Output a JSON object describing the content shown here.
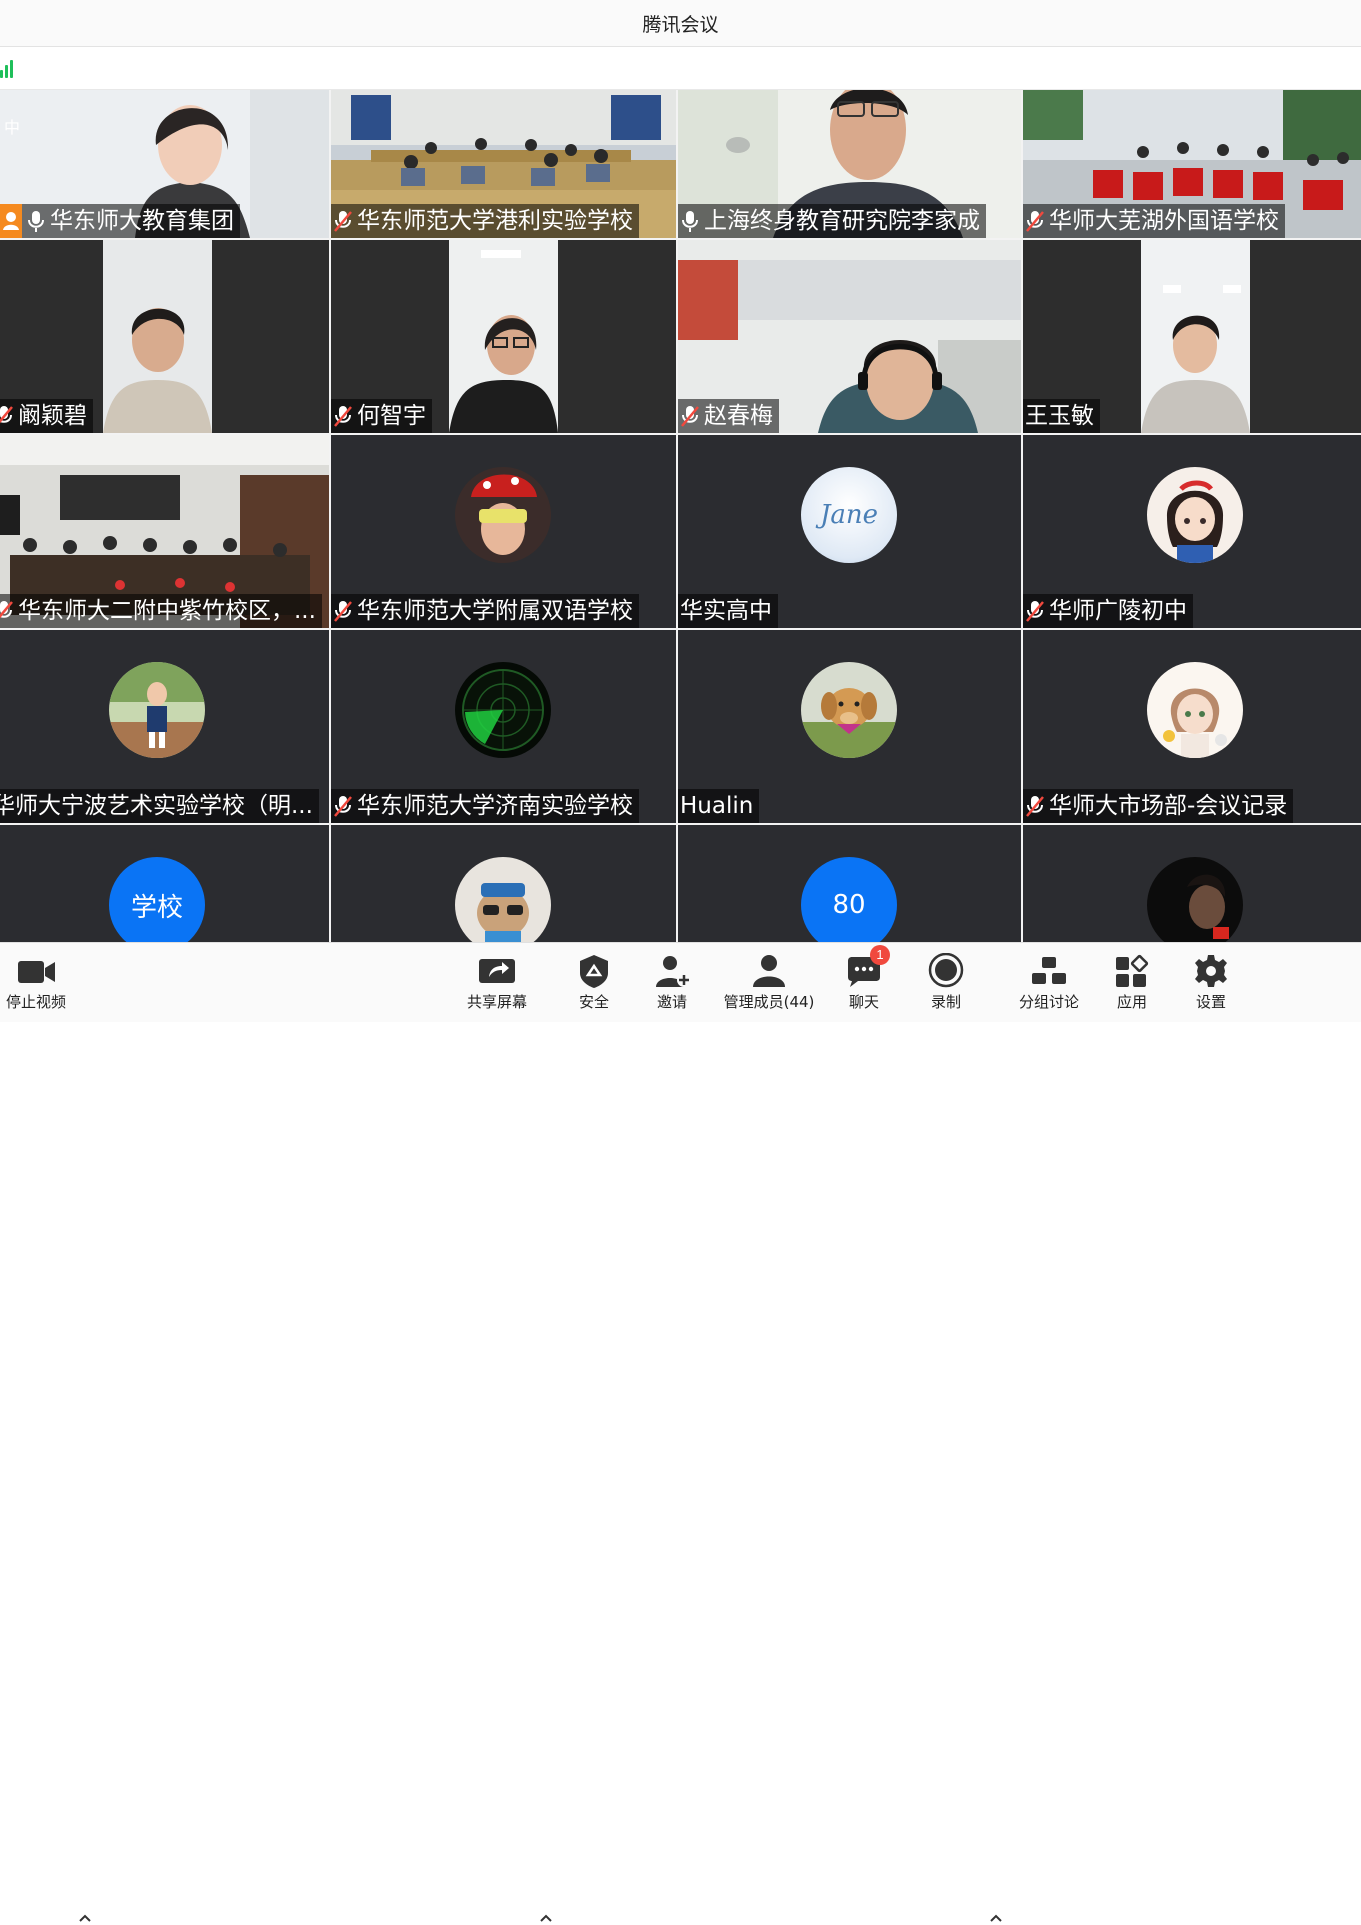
{
  "window": {
    "title": "腾讯会议"
  },
  "participants": [
    {
      "name": "华东师大教育集团",
      "mic": "on",
      "host_icon": true
    },
    {
      "name": "华东师范大学港利实验学校",
      "mic": "muted"
    },
    {
      "name": "上海终身教育研究院李家成",
      "mic": "on"
    },
    {
      "name": "华师大芜湖外国语学校",
      "mic": "muted"
    },
    {
      "name": "阚颖碧",
      "mic": "muted"
    },
    {
      "name": "何智宇",
      "mic": "muted"
    },
    {
      "name": "赵春梅",
      "mic": "muted"
    },
    {
      "name": "王玉敏",
      "mic": "none"
    },
    {
      "name": "华东师大二附中紫竹校区，...",
      "mic": "muted"
    },
    {
      "name": "华东师范大学附属双语学校",
      "mic": "muted"
    },
    {
      "name": "华实高中",
      "mic": "none",
      "avatar_text": "Jane"
    },
    {
      "name": "华师广陵初中",
      "mic": "muted"
    },
    {
      "name": "华师大宁波艺术实验学校（明...",
      "mic": "none"
    },
    {
      "name": "华东师范大学济南实验学校",
      "mic": "muted"
    },
    {
      "name": "Hualin",
      "mic": "none"
    },
    {
      "name": "华师大市场部-会议记录",
      "mic": "muted"
    },
    {
      "avatar_text": "学校"
    },
    {},
    {
      "avatar_text": "80"
    },
    {}
  ],
  "side_glyph": "中",
  "toolbar": {
    "stop_video": "停止视频",
    "share_screen": "共享屏幕",
    "security": "安全",
    "invite": "邀请",
    "manage_members": "管理成员(44)",
    "chat": "聊天",
    "chat_badge": "1",
    "record": "录制",
    "breakout": "分组讨论",
    "apps": "应用",
    "settings": "设置"
  },
  "colors": {
    "accent_blue": "#0a74f5",
    "signal_green": "#1fbf5a",
    "muted_red": "#f0493e",
    "tile_bg": "#2b2c30"
  }
}
